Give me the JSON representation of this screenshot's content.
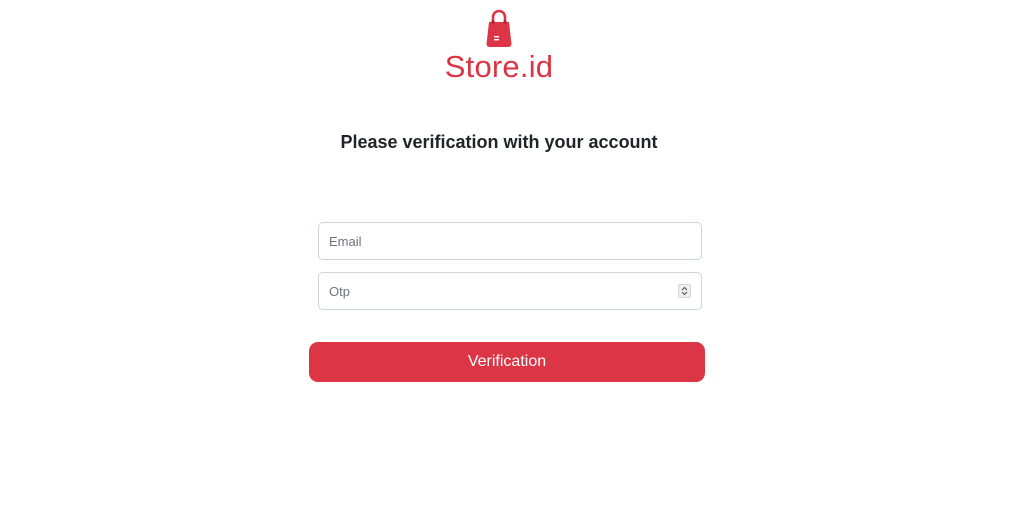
{
  "brand": {
    "name": "Store.id",
    "logo_icon": "shopping-bag-icon",
    "color": "#dc3545"
  },
  "heading": "Please verification with your account",
  "form": {
    "email_placeholder": "Email",
    "otp_placeholder": "Otp",
    "otp_spinner_icon": "number-spinner-icon",
    "submit_label": "Verification",
    "submit_color": "#dc3545"
  }
}
